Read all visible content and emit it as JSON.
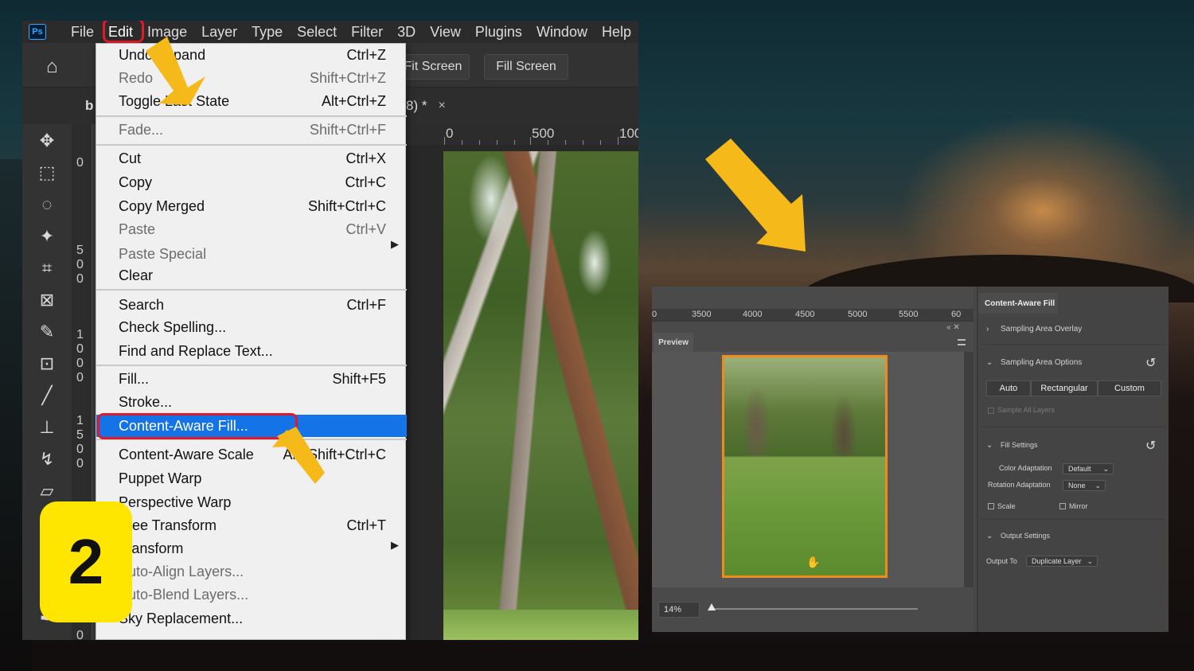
{
  "menubar": {
    "logo": "Ps",
    "items": [
      "File",
      "Edit",
      "Image",
      "Layer",
      "Type",
      "Select",
      "Filter",
      "3D",
      "View",
      "Plugins",
      "Window",
      "Help"
    ]
  },
  "options_bar": {
    "fit_screen": "Fit Screen",
    "fill_screen": "Fill Screen"
  },
  "document_tab": {
    "title": "8) *",
    "close": "×",
    "left_fragment": "b"
  },
  "ruler": {
    "h": [
      "0",
      "500",
      "100"
    ],
    "v": [
      "0",
      "5",
      "0",
      "0",
      "1",
      "0",
      "0",
      "0",
      "1",
      "5",
      "0",
      "0",
      "0"
    ]
  },
  "edit_menu": {
    "items": [
      {
        "label": "Undo Expand",
        "shortcut": "Ctrl+Z",
        "dim": false
      },
      {
        "label": "Redo",
        "shortcut": "Shift+Ctrl+Z",
        "dim": true
      },
      {
        "label": "Toggle Last State",
        "shortcut": "Alt+Ctrl+Z",
        "dim": false
      },
      {
        "label": "Fade...",
        "shortcut": "Shift+Ctrl+F",
        "dim": true
      },
      {
        "label": "Cut",
        "shortcut": "Ctrl+X",
        "dim": false
      },
      {
        "label": "Copy",
        "shortcut": "Ctrl+C",
        "dim": false
      },
      {
        "label": "Copy Merged",
        "shortcut": "Shift+Ctrl+C",
        "dim": false
      },
      {
        "label": "Paste",
        "shortcut": "Ctrl+V",
        "dim": true
      },
      {
        "label": "Paste Special",
        "shortcut": "",
        "dim": true
      },
      {
        "label": "Clear",
        "shortcut": "",
        "dim": false
      },
      {
        "label": "Search",
        "shortcut": "Ctrl+F",
        "dim": false
      },
      {
        "label": "Check Spelling...",
        "shortcut": "",
        "dim": false
      },
      {
        "label": "Find and Replace Text...",
        "shortcut": "",
        "dim": false
      },
      {
        "label": "Fill...",
        "shortcut": "Shift+F5",
        "dim": false
      },
      {
        "label": "Stroke...",
        "shortcut": "",
        "dim": false
      },
      {
        "label": "Content-Aware Fill...",
        "shortcut": "",
        "dim": false
      },
      {
        "label": "Content-Aware Scale",
        "shortcut": "Alt+Shift+Ctrl+C",
        "dim": false
      },
      {
        "label": "Puppet Warp",
        "shortcut": "",
        "dim": false
      },
      {
        "label": "Perspective Warp",
        "shortcut": "",
        "dim": false
      },
      {
        "label": "Free Transform",
        "shortcut": "Ctrl+T",
        "dim": false
      },
      {
        "label": "Transform",
        "shortcut": "",
        "dim": false
      },
      {
        "label": "Auto-Align Layers...",
        "shortcut": "",
        "dim": false
      },
      {
        "label": "Auto-Blend Layers...",
        "shortcut": "",
        "dim": false
      },
      {
        "label": "Sky Replacement...",
        "shortcut": "",
        "dim": false
      }
    ]
  },
  "step_badge": "2",
  "content_aware_fill": {
    "ruler": [
      "0",
      "3500",
      "4000",
      "4500",
      "5000",
      "5500",
      "60"
    ],
    "preview_tab": "Preview",
    "zoom": "14%",
    "panel_title": "Content-Aware Fill",
    "sampling_area_overlay": "Sampling Area Overlay",
    "sampling_area_options": "Sampling Area Options",
    "segments": [
      "Auto",
      "Rectangular",
      "Custom"
    ],
    "sample_all_layers": "Sample All Layers",
    "fill_settings": "Fill Settings",
    "color_adaptation_label": "Color Adaptation",
    "color_adaptation_value": "Default",
    "rotation_adaptation_label": "Rotation Adaptation",
    "rotation_adaptation_value": "None",
    "scale": "Scale",
    "mirror": "Mirror",
    "output_settings": "Output Settings",
    "output_to_label": "Output To",
    "output_to_value": "Duplicate Layer"
  },
  "colors": {
    "highlight_red": "#e0192b",
    "selection_blue": "#1473e6",
    "arrow_yellow": "#f6b91a",
    "badge_yellow": "#ffe600",
    "preview_border": "#f08a1c"
  }
}
